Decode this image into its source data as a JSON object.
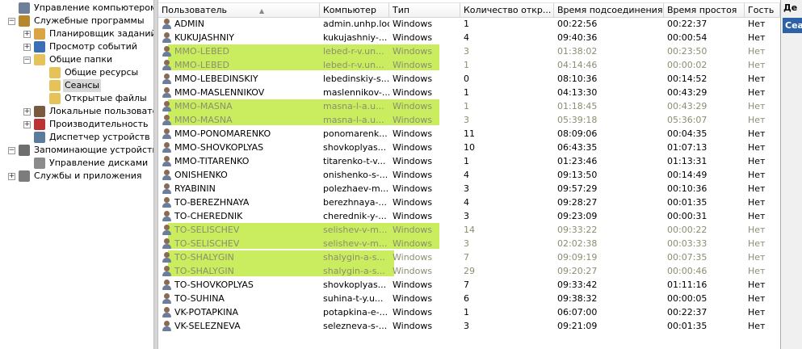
{
  "tree": {
    "items": [
      {
        "label": "Управление компьютером (лока",
        "level": 0,
        "expander": "",
        "icon": "computer-management-icon"
      },
      {
        "label": "Служебные программы",
        "level": 0,
        "expander": "−",
        "icon": "tools-icon"
      },
      {
        "label": "Планировщик заданий",
        "level": 1,
        "expander": "+",
        "icon": "task-scheduler-icon"
      },
      {
        "label": "Просмотр событий",
        "level": 1,
        "expander": "+",
        "icon": "event-viewer-icon"
      },
      {
        "label": "Общие папки",
        "level": 1,
        "expander": "−",
        "icon": "shared-folders-icon"
      },
      {
        "label": "Общие ресурсы",
        "level": 2,
        "expander": "",
        "icon": "shares-icon"
      },
      {
        "label": "Сеансы",
        "level": 2,
        "expander": "",
        "icon": "sessions-icon",
        "selected": true
      },
      {
        "label": "Открытые файлы",
        "level": 2,
        "expander": "",
        "icon": "open-files-icon"
      },
      {
        "label": "Локальные пользовател",
        "level": 1,
        "expander": "+",
        "icon": "local-users-icon"
      },
      {
        "label": "Производительность",
        "level": 1,
        "expander": "+",
        "icon": "performance-icon"
      },
      {
        "label": "Диспетчер устройств",
        "level": 1,
        "expander": "",
        "icon": "device-manager-icon"
      },
      {
        "label": "Запоминающие устройства",
        "level": 0,
        "expander": "−",
        "icon": "storage-icon"
      },
      {
        "label": "Управление дисками",
        "level": 1,
        "expander": "",
        "icon": "disk-management-icon"
      },
      {
        "label": "Службы и приложения",
        "level": 0,
        "expander": "+",
        "icon": "services-icon"
      }
    ]
  },
  "table": {
    "columns": [
      "Пользователь",
      "Компьютер",
      "Тип",
      "Количество откр...",
      "Время подсоединения",
      "Время простоя",
      "Гость"
    ],
    "sorted_indicator": "▲",
    "rows": [
      [
        "ADMIN",
        "admin.unhp.loc",
        "Windows",
        "1",
        "00:22:56",
        "00:22:37",
        "Нет"
      ],
      [
        "KUKUJASHNIY",
        "kukujashniy-...",
        "Windows",
        "4",
        "09:40:36",
        "00:00:54",
        "Нет"
      ],
      [
        "MMO-LEBED",
        "lebed-r-v.un...",
        "Windows",
        "3",
        "01:38:02",
        "00:23:50",
        "Нет"
      ],
      [
        "MMO-LEBED",
        "lebed-r-v.un...",
        "Windows",
        "1",
        "04:14:46",
        "00:00:02",
        "Нет"
      ],
      [
        "MMO-LEBEDINSKIY",
        "lebedinskiy-s...",
        "Windows",
        "0",
        "08:10:36",
        "00:14:52",
        "Нет"
      ],
      [
        "MMO-MASLENNIKOV",
        "maslennikov-...",
        "Windows",
        "1",
        "04:13:30",
        "00:43:29",
        "Нет"
      ],
      [
        "MMO-MASNA",
        "masna-l-a.u...",
        "Windows",
        "1",
        "01:18:45",
        "00:43:29",
        "Нет"
      ],
      [
        "MMO-MASNA",
        "masna-l-a.u...",
        "Windows",
        "3",
        "05:39:18",
        "05:36:07",
        "Нет"
      ],
      [
        "MMO-PONOMARENKO",
        "ponomarenk...",
        "Windows",
        "11",
        "08:09:06",
        "00:04:35",
        "Нет"
      ],
      [
        "MMO-SHOVKOPLYAS",
        "shovkoplyas...",
        "Windows",
        "10",
        "06:43:35",
        "01:07:13",
        "Нет"
      ],
      [
        "MMO-TITARENKO",
        "titarenko-t-v...",
        "Windows",
        "1",
        "01:23:46",
        "01:13:31",
        "Нет"
      ],
      [
        "ONISHENKO",
        "onishenko-s-...",
        "Windows",
        "4",
        "09:13:50",
        "00:14:49",
        "Нет"
      ],
      [
        "RYABININ",
        "polezhaev-m...",
        "Windows",
        "3",
        "09:57:29",
        "00:10:36",
        "Нет"
      ],
      [
        "TO-BEREZHNAYA",
        "berezhnaya-...",
        "Windows",
        "4",
        "09:28:27",
        "00:01:35",
        "Нет"
      ],
      [
        "TO-CHEREDNIK",
        "cherednik-y-...",
        "Windows",
        "3",
        "09:23:09",
        "00:00:31",
        "Нет"
      ],
      [
        "TO-SELISCHEV",
        "selishev-v-m...",
        "Windows",
        "14",
        "09:33:22",
        "00:00:22",
        "Нет"
      ],
      [
        "TO-SELISCHEV",
        "selishev-v-m...",
        "Windows",
        "3",
        "02:02:38",
        "00:03:33",
        "Нет"
      ],
      [
        "TO-SHALYGIN",
        "shalygin-a-s...",
        "Windows",
        "7",
        "09:09:19",
        "00:07:35",
        "Нет"
      ],
      [
        "TO-SHALYGIN",
        "shalygin-a-s...",
        "Windows",
        "29",
        "09:20:27",
        "00:00:46",
        "Нет"
      ],
      [
        "TO-SHOVKOPLYAS",
        "shovkoplyas...",
        "Windows",
        "7",
        "09:33:42",
        "01:11:16",
        "Нет"
      ],
      [
        "TO-SUHINA",
        "suhina-t-y.u...",
        "Windows",
        "6",
        "09:38:32",
        "00:00:05",
        "Нет"
      ],
      [
        "VK-POTAPKINA",
        "potapkina-e-...",
        "Windows",
        "1",
        "06:07:00",
        "00:22:37",
        "Нет"
      ],
      [
        "VK-SELEZNEVA",
        "selezneva-s-...",
        "Windows",
        "3",
        "09:21:09",
        "00:01:35",
        "Нет"
      ]
    ],
    "highlighted_rows": [
      2,
      3,
      6,
      7,
      15,
      16,
      17,
      18
    ],
    "highlight_color": "#c7ec57"
  },
  "right_panel": {
    "title": "Де",
    "item": "Сеа"
  }
}
